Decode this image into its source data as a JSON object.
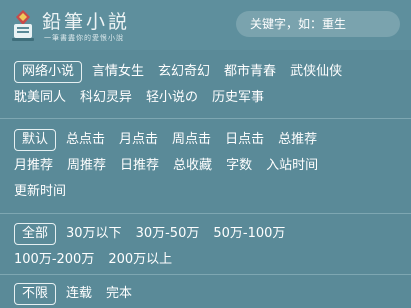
{
  "header": {
    "logo_title": "鉛筆小説",
    "logo_subtitle": "一筆書盡你的愛恨小說",
    "search_placeholder": "关键字，如：重生"
  },
  "filters": {
    "category": {
      "rows": [
        [
          "网络小说",
          "言情女生",
          "玄幻奇幻",
          "都市青春",
          "武侠仙侠"
        ],
        [
          "耽美同人",
          "科幻灵异",
          "轻小说の",
          "历史军事"
        ]
      ],
      "selected": "网络小说"
    },
    "sort": {
      "rows": [
        [
          "默认",
          "总点击",
          "月点击",
          "周点击",
          "日点击",
          "总推荐"
        ],
        [
          "月推荐",
          "周推荐",
          "日推荐",
          "总收藏",
          "字数",
          "入站时间"
        ],
        [
          "更新时间"
        ]
      ],
      "selected": "默认"
    },
    "word_count": {
      "rows": [
        [
          "全部",
          "30万以下",
          "30万-50万",
          "50万-100万"
        ],
        [
          "100万-200万",
          "200万以上"
        ]
      ],
      "selected": "全部"
    },
    "status": {
      "rows": [
        [
          "不限",
          "连载",
          "完本"
        ]
      ],
      "selected": "不限"
    }
  }
}
